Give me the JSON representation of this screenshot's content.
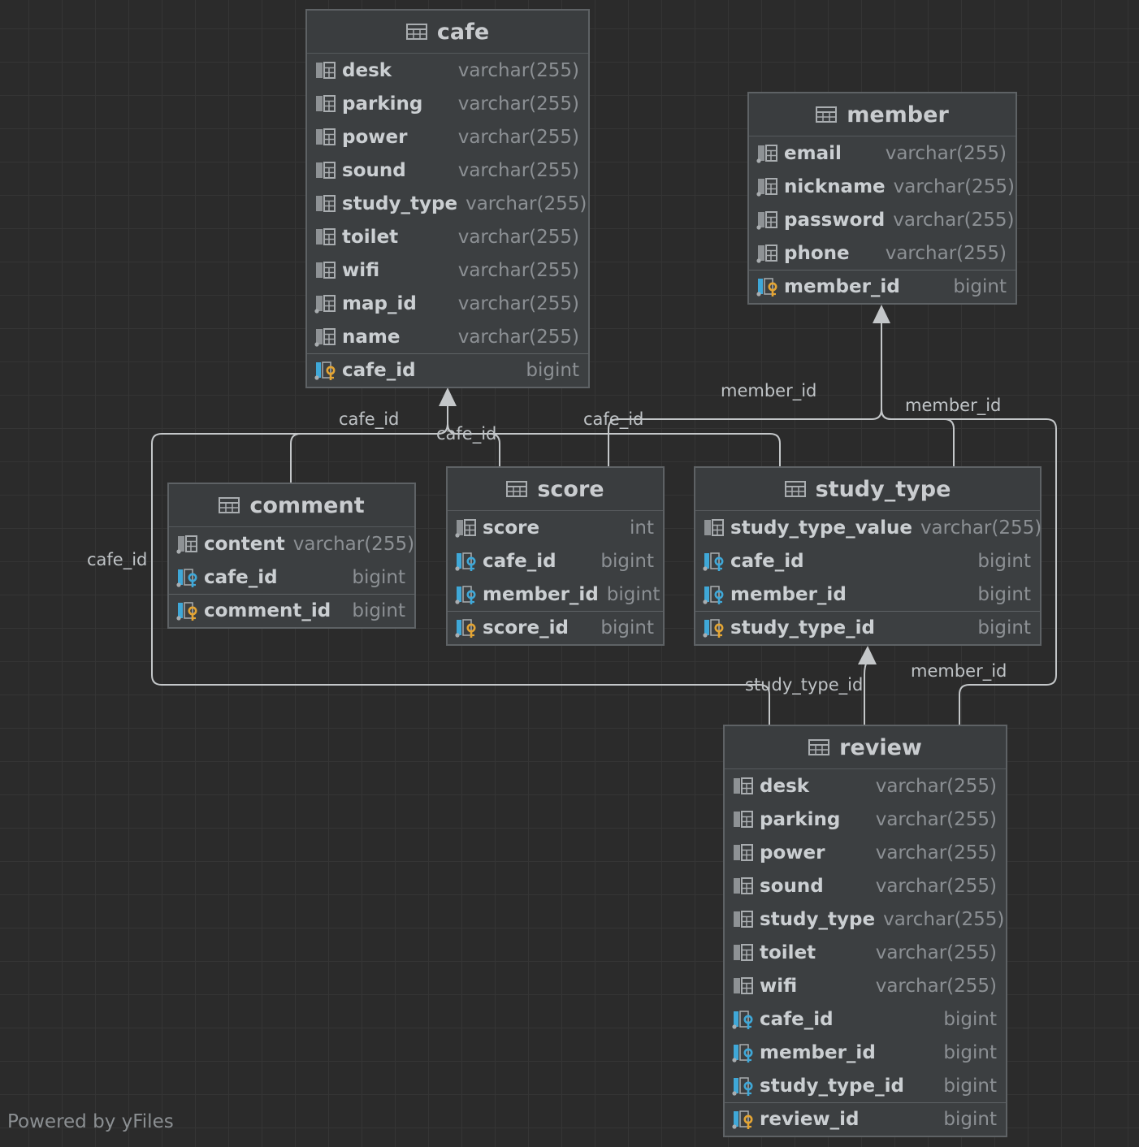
{
  "tables": [
    {
      "id": "cafe",
      "title": "cafe",
      "columns": [
        {
          "name": "desk",
          "type": "varchar(255)",
          "kind": "col"
        },
        {
          "name": "parking",
          "type": "varchar(255)",
          "kind": "col"
        },
        {
          "name": "power",
          "type": "varchar(255)",
          "kind": "col"
        },
        {
          "name": "sound",
          "type": "varchar(255)",
          "kind": "col"
        },
        {
          "name": "study_type",
          "type": "varchar(255)",
          "kind": "col"
        },
        {
          "name": "toilet",
          "type": "varchar(255)",
          "kind": "col"
        },
        {
          "name": "wifi",
          "type": "varchar(255)",
          "kind": "col"
        },
        {
          "name": "map_id",
          "type": "varchar(255)",
          "kind": "col-nn"
        },
        {
          "name": "name",
          "type": "varchar(255)",
          "kind": "col-nn"
        },
        {
          "name": "cafe_id",
          "type": "bigint",
          "kind": "pk"
        }
      ]
    },
    {
      "id": "member",
      "title": "member",
      "columns": [
        {
          "name": "email",
          "type": "varchar(255)",
          "kind": "col-nn"
        },
        {
          "name": "nickname",
          "type": "varchar(255)",
          "kind": "col-nn"
        },
        {
          "name": "password",
          "type": "varchar(255)",
          "kind": "col-nn"
        },
        {
          "name": "phone",
          "type": "varchar(255)",
          "kind": "col-nn"
        },
        {
          "name": "member_id",
          "type": "bigint",
          "kind": "pk"
        }
      ]
    },
    {
      "id": "comment",
      "title": "comment",
      "columns": [
        {
          "name": "content",
          "type": "varchar(255)",
          "kind": "col-nn"
        },
        {
          "name": "cafe_id",
          "type": "bigint",
          "kind": "fk"
        },
        {
          "name": "comment_id",
          "type": "bigint",
          "kind": "pk"
        }
      ]
    },
    {
      "id": "score",
      "title": "score",
      "columns": [
        {
          "name": "score",
          "type": "int",
          "kind": "col-nn"
        },
        {
          "name": "cafe_id",
          "type": "bigint",
          "kind": "fk"
        },
        {
          "name": "member_id",
          "type": "bigint",
          "kind": "fk"
        },
        {
          "name": "score_id",
          "type": "bigint",
          "kind": "pk"
        }
      ]
    },
    {
      "id": "study_type",
      "title": "study_type",
      "columns": [
        {
          "name": "study_type_value",
          "type": "varchar(255)",
          "kind": "col"
        },
        {
          "name": "cafe_id",
          "type": "bigint",
          "kind": "fk"
        },
        {
          "name": "member_id",
          "type": "bigint",
          "kind": "fk"
        },
        {
          "name": "study_type_id",
          "type": "bigint",
          "kind": "pk"
        }
      ]
    },
    {
      "id": "review",
      "title": "review",
      "columns": [
        {
          "name": "desk",
          "type": "varchar(255)",
          "kind": "col"
        },
        {
          "name": "parking",
          "type": "varchar(255)",
          "kind": "col"
        },
        {
          "name": "power",
          "type": "varchar(255)",
          "kind": "col"
        },
        {
          "name": "sound",
          "type": "varchar(255)",
          "kind": "col"
        },
        {
          "name": "study_type",
          "type": "varchar(255)",
          "kind": "col"
        },
        {
          "name": "toilet",
          "type": "varchar(255)",
          "kind": "col"
        },
        {
          "name": "wifi",
          "type": "varchar(255)",
          "kind": "col"
        },
        {
          "name": "cafe_id",
          "type": "bigint",
          "kind": "fk"
        },
        {
          "name": "member_id",
          "type": "bigint",
          "kind": "fk"
        },
        {
          "name": "study_type_id",
          "type": "bigint",
          "kind": "fk"
        },
        {
          "name": "review_id",
          "type": "bigint",
          "kind": "pk"
        }
      ]
    }
  ],
  "edge_labels": [
    "cafe_id",
    "cafe_id",
    "cafe_id",
    "cafe_id",
    "member_id",
    "member_id",
    "member_id",
    "study_type_id"
  ],
  "footer": "Powered by yFiles",
  "colors": {
    "background": "#2b2b2b",
    "table": "#3c3f41",
    "border": "#5e6265",
    "edge": "#c4c7c9",
    "fk_key": "#3fa8d8",
    "pk_key": "#e4a534"
  }
}
